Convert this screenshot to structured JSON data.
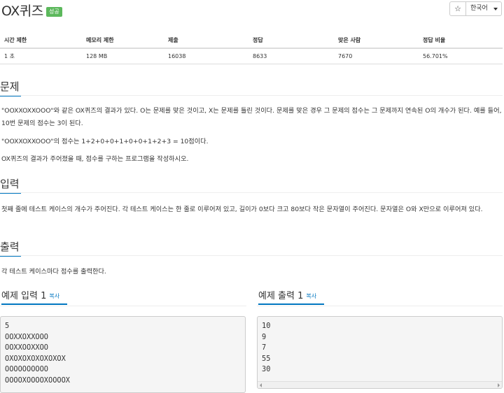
{
  "header": {
    "title": "OX퀴즈",
    "badge": "성공",
    "star": "☆",
    "language": "한국어"
  },
  "stats": {
    "headers": [
      "시간 제한",
      "메모리 제한",
      "제출",
      "정답",
      "맞은 사람",
      "정답 비율"
    ],
    "values": [
      "1 초",
      "128 MB",
      "16038",
      "8633",
      "7670",
      "56.701%"
    ]
  },
  "sections": {
    "problem": {
      "title": "문제",
      "p1": "\"OOXXOXXOOO\"와 같은 OX퀴즈의 결과가 있다. O는 문제를 맞은 것이고, X는 문제를 틀린 것이다. 문제를 맞은 경우 그 문제의 점수는 그 문제까지 연속된 O의 개수가 된다. 예를 들어, 10번 문제의 점수는 3이 된다.",
      "p2": "\"OOXXOXXOOO\"의 점수는 1+2+0+0+1+0+0+1+2+3 = 10점이다.",
      "p3": "OX퀴즈의 결과가 주어졌을 때, 점수를 구하는 프로그램을 작성하시오."
    },
    "input": {
      "title": "입력",
      "p1": "첫째 줄에 테스트 케이스의 개수가 주어진다. 각 테스트 케이스는 한 줄로 이루어져 있고, 길이가 0보다 크고 80보다 작은 문자열이 주어진다. 문자열은 O와 X만으로 이루어져 있다."
    },
    "output": {
      "title": "출력",
      "p1": "각 테스트 케이스마다 점수를 출력한다."
    }
  },
  "examples": {
    "input": {
      "title": "예제 입력 1",
      "copy": "복사",
      "lines": [
        "5",
        "OOXXOXXOOO",
        "OOXXOOXXOO",
        "OXOXOXOXOXOXOX",
        "OOOOOOOOOO",
        "OOOOXOOOOXOOOOX"
      ]
    },
    "output": {
      "title": "예제 출력 1",
      "copy": "복사",
      "lines": [
        "10",
        "9",
        "7",
        "55",
        "30"
      ]
    }
  },
  "colors": {
    "accent": "#0076c0",
    "success": "#5cb85c"
  }
}
